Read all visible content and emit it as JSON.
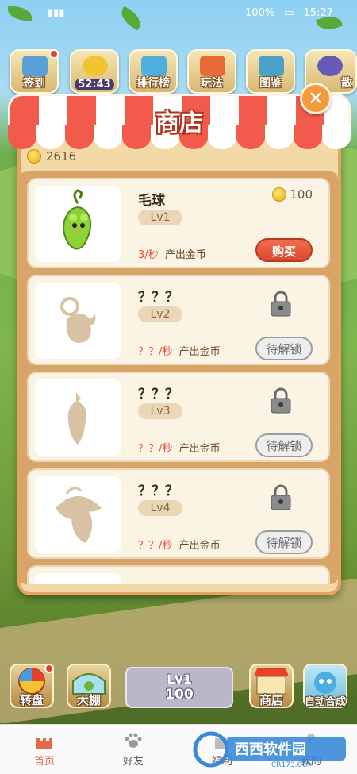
{
  "status_bar": {
    "battery": "100%",
    "time": "15:27"
  },
  "top_menu": {
    "sign_in": "签到",
    "timer": "52:43",
    "ranking": "排行榜",
    "how_to_play": "玩法",
    "album": "图鉴",
    "partial": "散"
  },
  "shop": {
    "title": "商店",
    "close_glyph": "✕",
    "coins": "2616",
    "items": [
      {
        "name": "毛球",
        "level": "Lv1",
        "rate_num": "3/秒",
        "rate_text": "产出金币",
        "price": "100",
        "button": "购买"
      },
      {
        "name": "？？？",
        "level": "Lv2",
        "rate_num": "？？/秒",
        "rate_text": "产出金币",
        "button": "待解锁"
      },
      {
        "name": "？？？",
        "level": "Lv3",
        "rate_num": "？？/秒",
        "rate_text": "产出金币",
        "button": "待解锁"
      },
      {
        "name": "？？？",
        "level": "Lv4",
        "rate_num": "？？/秒",
        "rate_text": "产出金币",
        "button": "待解锁"
      }
    ]
  },
  "game_bar": {
    "spin": "转盘",
    "shed": "大棚",
    "center_level": "Lv1",
    "center_value": "100",
    "shop": "商店",
    "auto_merge": "自动合成"
  },
  "tabs": [
    {
      "label": "首页",
      "icon": "castle-icon"
    },
    {
      "label": "好友",
      "icon": "paw-icon"
    },
    {
      "label": "福利",
      "icon": "gift-icon"
    },
    {
      "label": "我的",
      "icon": "user-icon"
    }
  ],
  "watermark": {
    "brand": "西西软件园",
    "domain": "CR173.COM"
  },
  "colors": {
    "accent": "#e06a4a",
    "awning_red": "#f25a4c",
    "buy_red": "#d84a30",
    "panel": "#f3d9a8"
  }
}
